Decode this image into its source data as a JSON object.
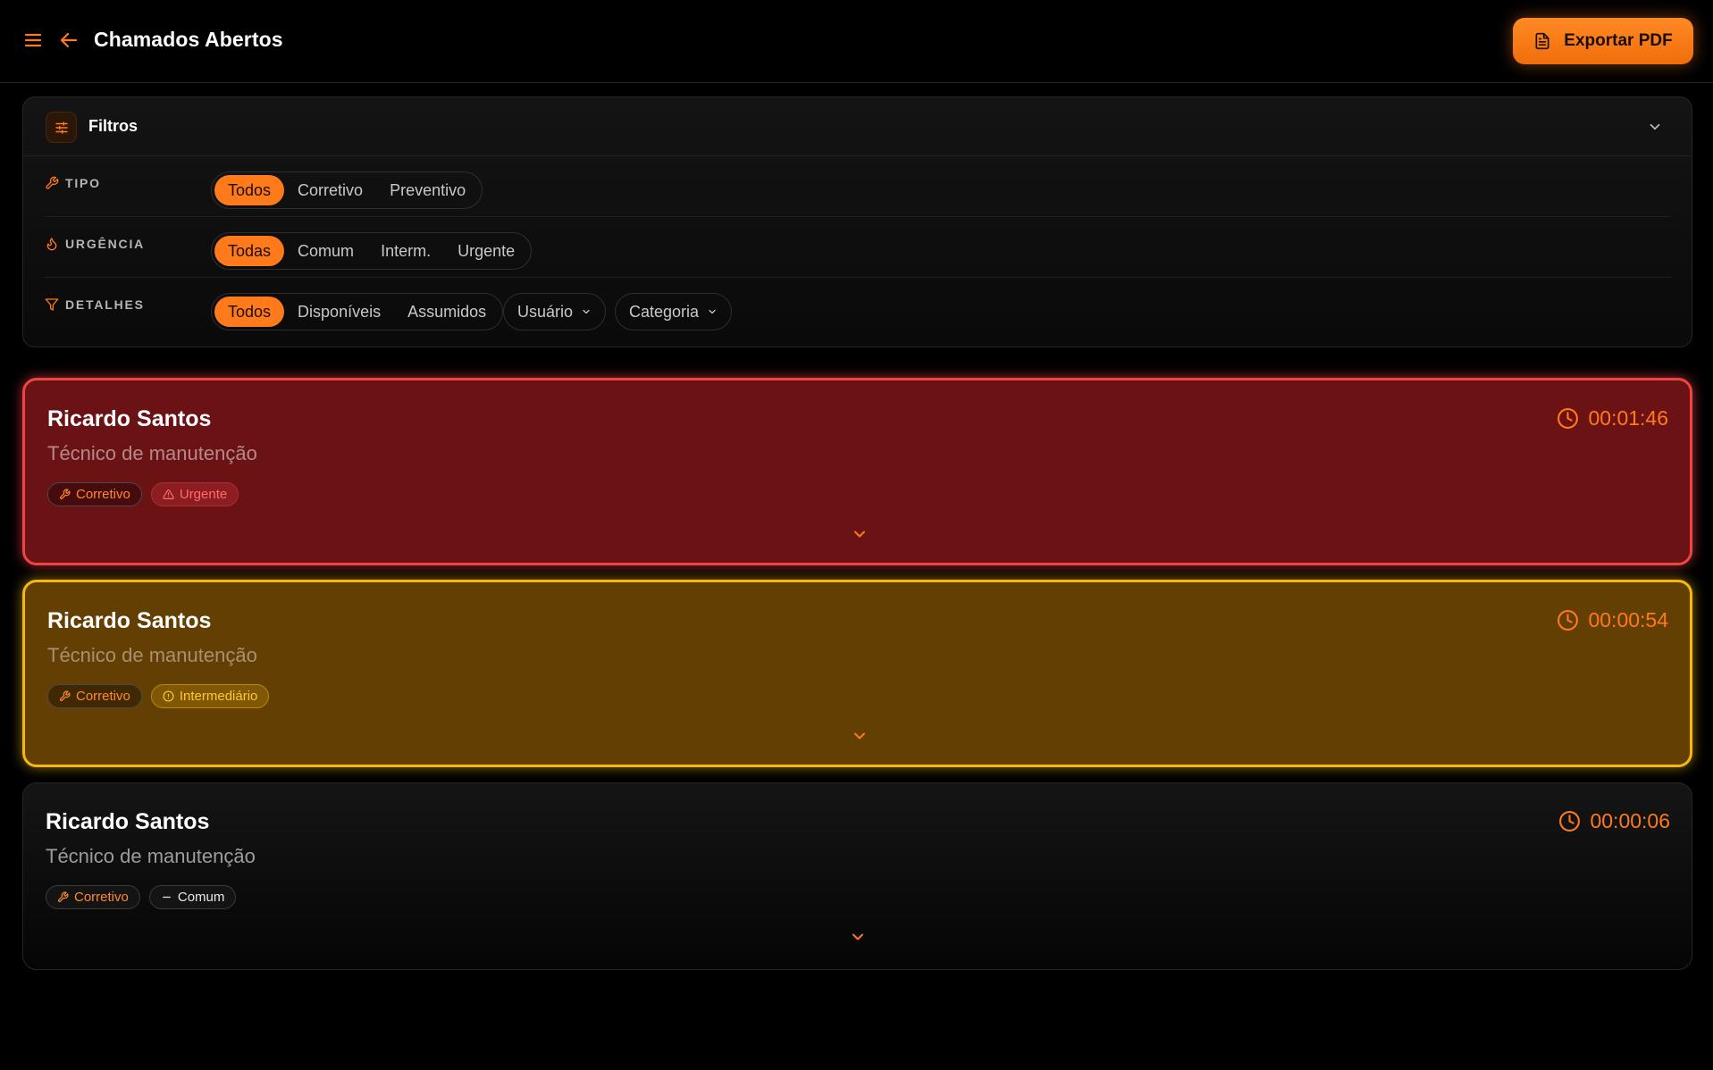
{
  "header": {
    "menu_icon": "menu-icon",
    "back_icon": "arrow-left-icon",
    "title": "Chamados Abertos",
    "export_label": "Exportar PDF",
    "export_icon": "file-text-icon"
  },
  "filters": {
    "title": "Filtros",
    "icon": "sliders-icon",
    "rows": {
      "tipo": {
        "label": "TIPO",
        "icon": "wrench-icon",
        "options": [
          "Todos",
          "Corretivo",
          "Preventivo"
        ],
        "selected": "Todos"
      },
      "urgencia": {
        "label": "URGÊNCIA",
        "icon": "flame-icon",
        "options": [
          "Todas",
          "Comum",
          "Interm.",
          "Urgente"
        ],
        "selected": "Todas"
      },
      "detalhes": {
        "label": "DETALHES",
        "icon": "filter-icon",
        "options": [
          "Todos",
          "Disponíveis",
          "Assumidos"
        ],
        "selected": "Todos",
        "dropdowns": [
          "Usuário",
          "Categoria"
        ]
      }
    }
  },
  "tickets": [
    {
      "name": "Ricardo Santos",
      "role": "Técnico de manutenção",
      "timer": "00:01:46",
      "type": "Corretivo",
      "urgency": "Urgente",
      "urgency_icon": "alert-triangle-icon",
      "accent": "#ef4346"
    },
    {
      "name": "Ricardo Santos",
      "role": "Técnico de manutenção",
      "timer": "00:00:54",
      "type": "Corretivo",
      "urgency": "Intermediário",
      "urgency_icon": "alert-circle-icon",
      "accent": "#f5b90a"
    },
    {
      "name": "Ricardo Santos",
      "role": "Técnico de manutenção",
      "timer": "00:00:06",
      "type": "Corretivo",
      "urgency": "Comum",
      "urgency_icon": "minus-icon",
      "accent": "#3a3a3a"
    }
  ],
  "colors": {
    "accent": "#ff7a1a",
    "background": "#000000",
    "urgent": "#ef4346",
    "intermediate": "#f5b90a"
  }
}
